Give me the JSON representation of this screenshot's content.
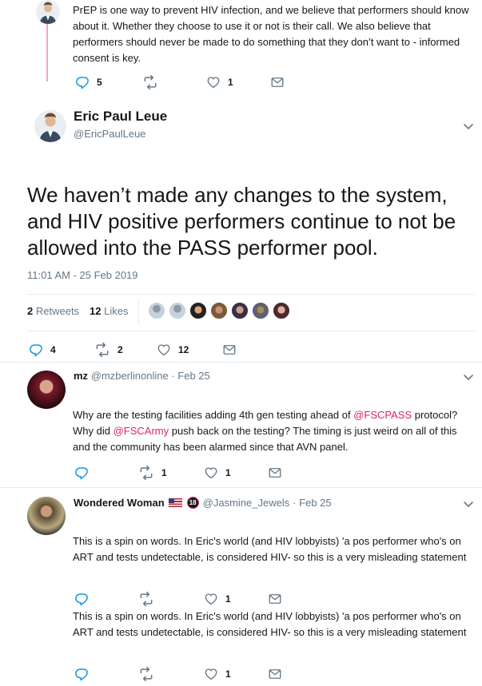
{
  "prev_tweet": {
    "text": "PrEP is one way to prevent HIV infection, and we believe that performers should know about it. Whether they choose to use it or not is their call. We also believe that performers should never be made to do something that they don’t want to - informed consent is key.",
    "replies": "5",
    "retweets": "",
    "likes": "1"
  },
  "main_tweet": {
    "name": "Eric Paul Leue",
    "handle": "@EricPaulLeue",
    "text": "We haven’t made any changes to the system, and HIV positive performers continue to not be allowed into the PASS performer pool.",
    "timestamp": "11:01 AM - 25 Feb 2019",
    "retweets_count": "2",
    "retweets_label": "Retweets",
    "likes_count": "12",
    "likes_label": "Likes",
    "actions": {
      "replies": "4",
      "retweets": "2",
      "likes": "12"
    }
  },
  "replies": [
    {
      "name": "mz",
      "handle": "@mzberlinonline",
      "date": "· Feb 25",
      "text_parts": {
        "a": "Why are the testing facilities adding 4th gen testing ahead of ",
        "mention1": "@FSCPASS",
        "b": " protocol? Why did ",
        "mention2": "@FSCArmy",
        "c": " push back on the testing? The timing is just weird on all of this and the community has been alarmed since that AVN panel."
      },
      "replies": "",
      "retweets": "1",
      "likes": "1"
    },
    {
      "name": "Wondered Woman",
      "flag": "🇺🇸",
      "badge": "18",
      "handle": "@Jasmine_Jewels",
      "date": "· Feb 25",
      "text": "This is a spin on words. In Eric's world (and HIV lobbyists) 'a pos performer who's on ART and tests undetectable, is considered HIV- so this is a very misleading statement",
      "replies": "",
      "retweets": "",
      "likes": "1",
      "text2": "This is a spin on words. In Eric's world (and HIV lobbyists) 'a pos performer who's on ART and tests undetectable, is considered HIV- so this is a very misleading statement",
      "likes2": "1"
    }
  ],
  "colors": {
    "accent": "#e0245e",
    "muted": "#657786",
    "thread": "#f2a5bf"
  }
}
